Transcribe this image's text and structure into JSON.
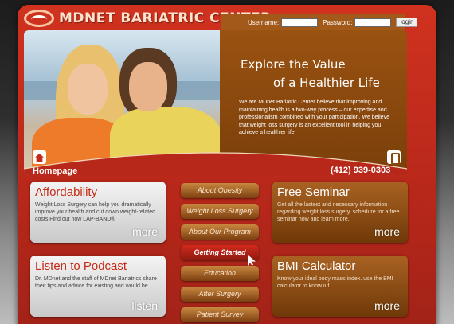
{
  "brand": {
    "name": "MDNET BARIATRIC CENTER"
  },
  "login": {
    "username_label": "Username:",
    "password_label": "Password:",
    "button_label": "login",
    "username_value": "",
    "password_value": ""
  },
  "hero": {
    "title_line1": "Explore the Value",
    "title_line2": "of a Healthier Life",
    "body": "We are MDnet Bariatric Center believe that improving and maintaining health is a two-way process – our expertise and professionalism combined with your participation. We believe that weight loss surgery is an excellent tool in helping you achieve a healthier life."
  },
  "home": {
    "label": "Homepage",
    "icon": "home-icon"
  },
  "phone": {
    "number": "(412) 939-0303",
    "icon": "phone-icon"
  },
  "cards": {
    "affordability": {
      "title": "Affordability",
      "body": "Weight Loss Surgery can help you dramatically improve your health and cut down weight-related costs.Find out how LAP-BAND®",
      "more": "more"
    },
    "podcast": {
      "title": "Listen to Podcast",
      "body": "Dr. MDnet and the staff of MDnet Bariatrics share their tips and advice for existing and would be",
      "more": "listen"
    },
    "seminar": {
      "title": "Free Seminar",
      "body": "Get all the lastest and necessary information regarding weight loss surgery. schedure for a free seminar now and learn more.",
      "more": "more"
    },
    "bmi": {
      "title": "BMI Calculator",
      "body": "Know your ideal body mass index. use the BMI calculator to know iuf",
      "more": "more"
    }
  },
  "nav": [
    "About Obesity",
    "Weight Loss Surgery",
    "About Our Program",
    "Getting Started",
    "Education",
    "After Surgery",
    "Patient Survey"
  ],
  "colors": {
    "brand_red": "#c32a1b",
    "brown": "#8a4610",
    "cream": "#fde4cf"
  }
}
